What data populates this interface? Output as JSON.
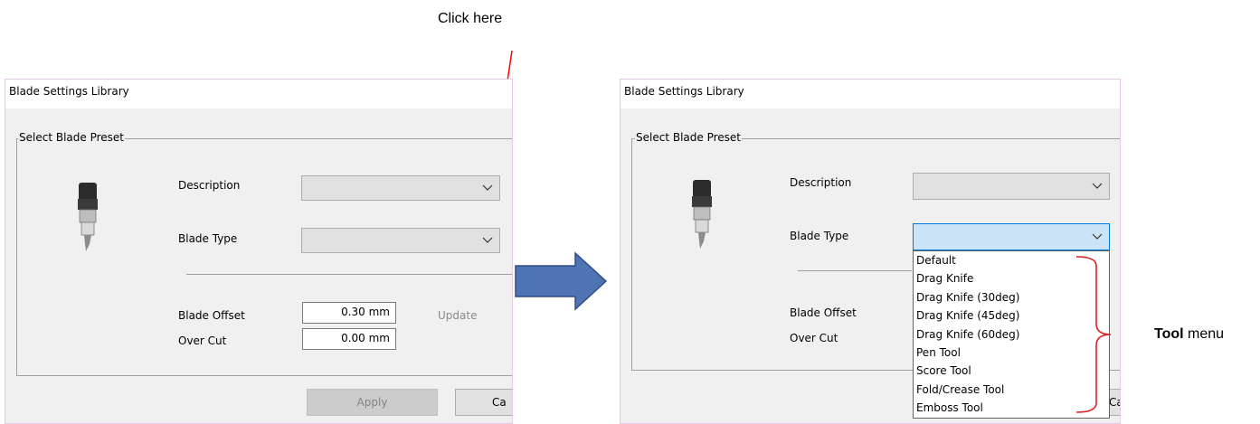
{
  "annotations": {
    "click_here": "Click here",
    "tool_menu_bold": "Tool",
    "tool_menu_rest": " menu"
  },
  "colors": {
    "annotation_arrow": "#ff0000",
    "bracket": "#e02020",
    "big_arrow_fill": "#4f74b4",
    "big_arrow_stroke": "#2f4e86",
    "window_border": "#e3c9e6",
    "dropdown_open": "#cce4f7"
  },
  "before": {
    "title": "Blade Settings Library",
    "group_label": "Select Blade Preset",
    "description_label": "Description",
    "blade_type_label": "Blade Type",
    "blade_offset_label": "Blade Offset",
    "blade_offset_value": "0.30 mm",
    "over_cut_label": "Over Cut",
    "over_cut_value": "0.00 mm",
    "update_label": "Update",
    "apply_label": "Apply",
    "cancel_label": "Ca"
  },
  "after": {
    "title": "Blade Settings Library",
    "group_label": "Select Blade Preset",
    "description_label": "Description",
    "blade_type_label": "Blade Type",
    "blade_offset_label": "Blade Offset",
    "over_cut_label": "Over Cut",
    "cancel_label": "Ca",
    "tool_options": [
      "Default",
      "Drag Knife",
      "Drag Knife (30deg)",
      "Drag Knife (45deg)",
      "Drag Knife (60deg)",
      "Pen Tool",
      "Score Tool",
      "Fold/Crease Tool",
      "Emboss Tool"
    ]
  }
}
